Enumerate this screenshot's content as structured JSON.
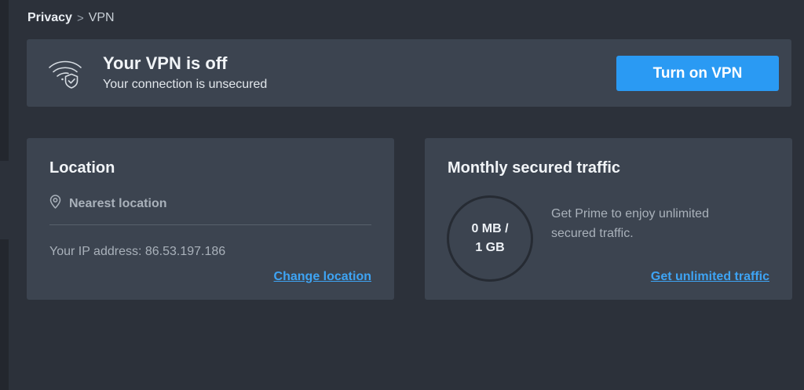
{
  "breadcrumb": {
    "parent": "Privacy",
    "separator": ">",
    "current": "VPN"
  },
  "banner": {
    "icon": "wifi-shield-icon",
    "title": "Your VPN is off",
    "subtitle": "Your connection is unsecured",
    "button_label": "Turn on VPN"
  },
  "location": {
    "title": "Location",
    "icon": "map-pin-icon",
    "current": "Nearest location",
    "ip_label": "Your IP address: 86.53.197.186",
    "link": "Change location"
  },
  "traffic": {
    "title": "Monthly secured traffic",
    "used": "0 MB /",
    "limit": "1 GB",
    "description": "Get Prime to enjoy unlimited secured traffic.",
    "link": "Get unlimited traffic"
  },
  "colors": {
    "background": "#2c313a",
    "card": "#3c4450",
    "accent": "#2a9af3",
    "link": "#3ea4f4"
  }
}
